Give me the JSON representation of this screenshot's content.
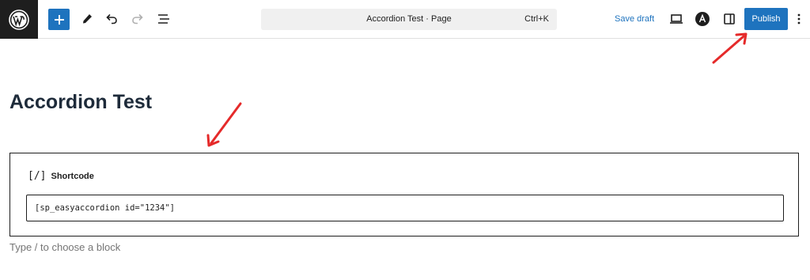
{
  "toolbar": {
    "document_title": "Accordion Test · Page",
    "command_shortcut": "Ctrl+K",
    "save_draft_label": "Save draft",
    "publish_label": "Publish",
    "icons": [
      "wordpress-logo",
      "plus-icon",
      "pencil-icon",
      "undo-icon",
      "redo-icon",
      "list-view-icon",
      "desktop-preview-icon",
      "astra-icon",
      "sidebar-toggle-icon",
      "more-options-icon"
    ]
  },
  "editor": {
    "page_title": "Accordion Test",
    "block_label": "Shortcode",
    "block_icon": "[/]",
    "shortcode_value": "[sp_easyaccordion id=\"1234\"]",
    "appender_placeholder": "Type / to choose a block"
  },
  "annotations": {
    "arrow_color": "#e52a2a"
  },
  "colors": {
    "accent": "#1e73be",
    "logo_bg": "#1e1e1e"
  }
}
